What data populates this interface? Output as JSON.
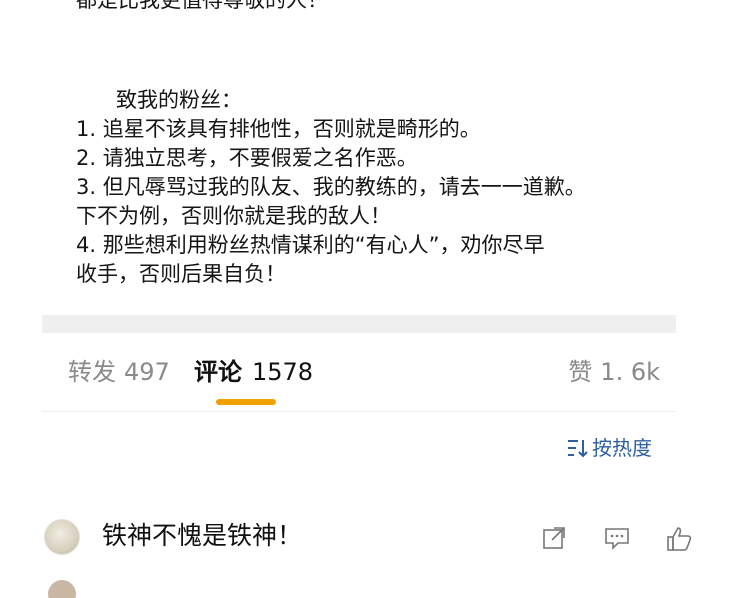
{
  "post": {
    "top_line": "都是比我更值得尊敬的人！",
    "greeting": "致我的粉丝：",
    "lines": [
      "1. 追星不该具有排他性，否则就是畸形的。",
      "2. 请独立思考，不要假爱之名作恶。",
      "3. 但凡辱骂过我的队友、我的教练的，请去一一道歉。",
      "下不为例，否则你就是我的敌人！",
      "4. 那些想利用粉丝热情谋利的“有心人”，劝你尽早",
      "收手，否则后果自负！"
    ]
  },
  "actions": {
    "repost_label": "转发",
    "repost_count": "497",
    "comment_label": "评论",
    "comment_count": "1578",
    "like_label": "赞",
    "like_count": "1. 6k"
  },
  "sort": {
    "label": "按热度",
    "icon": "sort-icon"
  },
  "comments": [
    {
      "text": "铁神不愧是铁神！",
      "icons": [
        "share-icon",
        "comment-icon",
        "like-icon"
      ]
    }
  ],
  "colors": {
    "accent": "#f0a000",
    "link": "#2f5f9e",
    "muted": "#8a8a8a"
  }
}
